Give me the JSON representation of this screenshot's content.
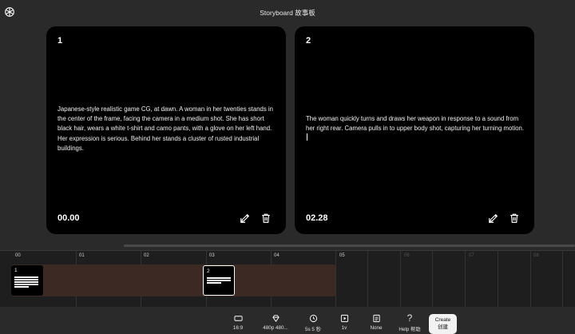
{
  "header": {
    "title": "Storyboard 故事板"
  },
  "cards": [
    {
      "number": "1",
      "text": "Japanese-style realistic game CG, at dawn. A woman in her twenties stands in the center of the frame, facing the camera in a medium shot. She has short black hair, wears a white t-shirt and camo pants, with a glove on her left hand. Her expression is serious. Behind her stands a cluster of rusted industrial buildings.",
      "time": "00.00"
    },
    {
      "number": "2",
      "text": "The woman quickly turns and draws her weapon in response to a sound from her right rear. Camera pulls in to upper body shot, capturing her turning motion.",
      "time": "02.28"
    }
  ],
  "timeline": {
    "ticks": [
      "00",
      "01",
      "02",
      "03",
      "04",
      "05",
      "06",
      "07",
      "08"
    ],
    "clips": [
      {
        "label": "1"
      },
      {
        "label": "2"
      }
    ]
  },
  "toolbar": {
    "aspect_label": "16:9",
    "quality_label": "480p 480...",
    "duration_label": "5s 5 秒",
    "variations_label": "1v",
    "preset_label": "None",
    "help_label": "Help 帮助",
    "create_label_en": "Create",
    "create_label_zh": "创建"
  },
  "colors": {
    "track_fill": "#3d2924",
    "card_bg": "#000000",
    "page_bg": "#2a2a2a"
  }
}
